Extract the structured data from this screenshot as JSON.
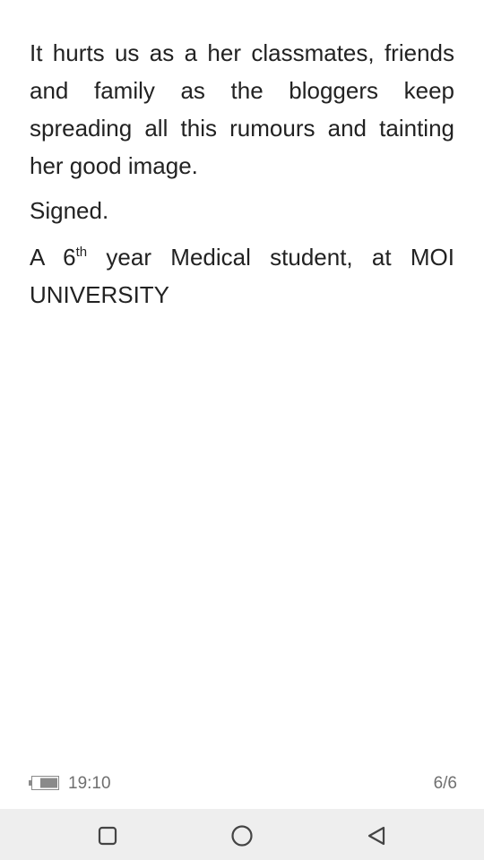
{
  "document": {
    "paragraph_1": "It hurts us as a her classmates, friends and family as the bloggers keep spreading all this rumours and tainting her good image.",
    "signed": "Signed.",
    "signature_prefix": "A 6",
    "signature_superscript": "th",
    "signature_suffix": " year Medical student, at MOI UNIVERSITY"
  },
  "status_bar": {
    "battery_icon": "battery-icon",
    "time": "19:10",
    "page_indicator": "6/6"
  },
  "nav_bar": {
    "buttons": [
      {
        "name": "recent-apps",
        "icon": "square-icon"
      },
      {
        "name": "home",
        "icon": "circle-icon"
      },
      {
        "name": "back",
        "icon": "triangle-back-icon"
      }
    ]
  }
}
